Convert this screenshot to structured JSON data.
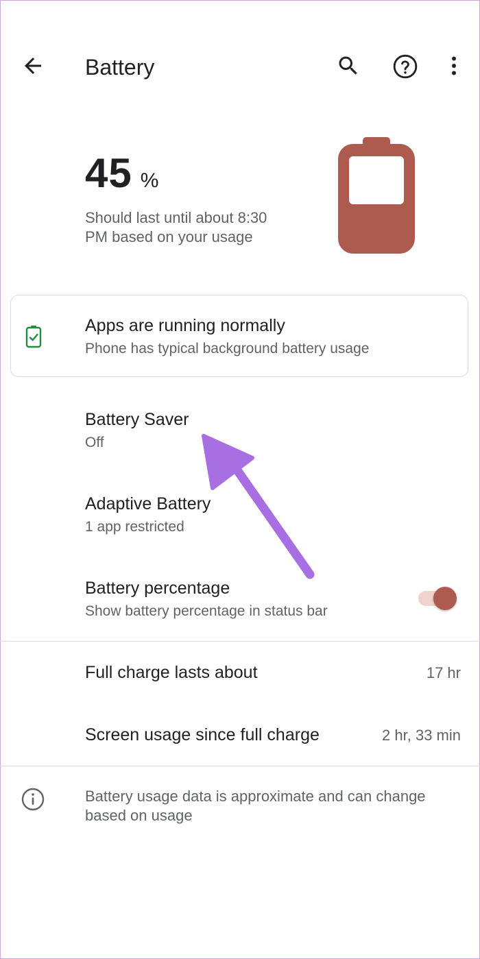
{
  "header": {
    "title": "Battery"
  },
  "battery": {
    "level": 45,
    "level_text": "45",
    "percent_sign": "%",
    "estimate": "Should last until about 8:30 PM based on your usage",
    "color": "#ad5b4e"
  },
  "status_card": {
    "title": "Apps are running normally",
    "subtitle": "Phone has typical background battery usage",
    "icon_color": "#1e8e3e"
  },
  "settings": {
    "battery_saver": {
      "title": "Battery Saver",
      "subtitle": "Off"
    },
    "adaptive_battery": {
      "title": "Adaptive Battery",
      "subtitle": "1 app restricted"
    },
    "battery_percentage": {
      "title": "Battery percentage",
      "subtitle": "Show battery percentage in status bar",
      "enabled": true
    }
  },
  "stats": {
    "full_charge": {
      "label": "Full charge lasts about",
      "value": "17 hr"
    },
    "screen_usage": {
      "label": "Screen usage since full charge",
      "value": "2 hr, 33 min"
    }
  },
  "footer": {
    "note": "Battery usage data is approximate and can change based on usage"
  },
  "annotation": {
    "arrow_color": "#a86fe3"
  }
}
